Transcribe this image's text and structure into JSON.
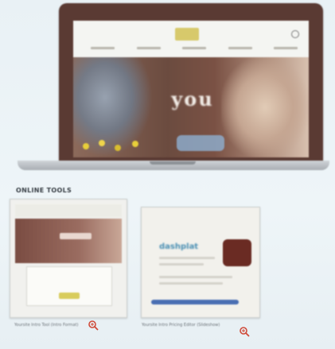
{
  "laptop": {
    "site": {
      "hero_text": "you"
    }
  },
  "section": {
    "heading": "ONLINE TOOLS"
  },
  "thumbnails": [
    {
      "caption": "Yoursite Intro Tool (Intro Format)"
    },
    {
      "caption": "Yoursite Intro Pricing Editor (Slideshow)"
    }
  ],
  "right_thumb": {
    "title": "dashplat"
  },
  "colors": {
    "accent_blue": "#4a6fb3",
    "brand_brown": "#5a3a33",
    "logo_yellow": "#d7c96b"
  },
  "icons": [
    "search-icon",
    "zoom-in-icon"
  ]
}
